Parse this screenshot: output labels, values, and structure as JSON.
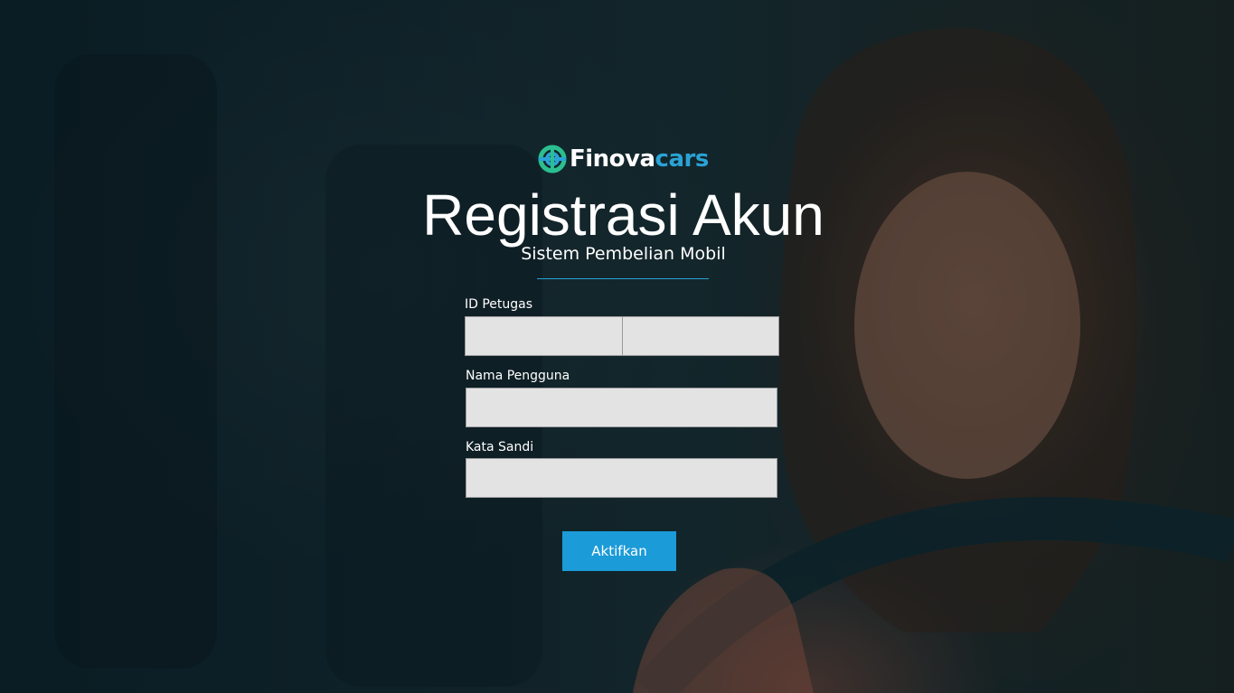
{
  "brand": {
    "name_part1": "Finova",
    "name_part2": "cars",
    "accent_color": "#2aa3d6",
    "logo_icon": "finovacars-logo-icon"
  },
  "header": {
    "title": "Registrasi Akun",
    "subtitle": "Sistem Pembelian Mobil"
  },
  "form": {
    "id_petugas": {
      "label": "ID Petugas",
      "value_part1": "",
      "value_part2": ""
    },
    "nama_pengguna": {
      "label": "Nama Pengguna",
      "value": ""
    },
    "kata_sandi": {
      "label": "Kata Sandi",
      "value": ""
    },
    "submit_label": "Aktifkan",
    "button_color": "#1b9bd8"
  }
}
